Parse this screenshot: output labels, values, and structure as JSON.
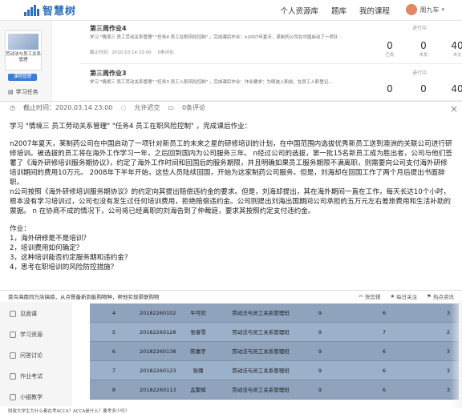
{
  "header": {
    "logo_text": "智慧树",
    "nav": [
      "个人资源库",
      "题库",
      "我的课程"
    ],
    "user_name": "周九车"
  },
  "sidebar": {
    "course_title": "劳动法与员工关系管理",
    "course_button": "课程管理",
    "item": "学习任务"
  },
  "tasks": [
    {
      "title": "第三周作业4",
      "desc": "学习 \"情境三 员工劳动关系管理\" \"任务4 员工在职风险控制\" ，完成课后作业：n2007年夏天，某制药公司在中国启动了一项针...",
      "deadline": "截止时间：2020.03.14 23:00",
      "comments": "0条评论",
      "status": "进行中",
      "stats": [
        {
          "n": "0",
          "l": "已批"
        },
        {
          "n": "0",
          "l": "未批"
        },
        {
          "n": "40",
          "l": "未交"
        }
      ]
    },
    {
      "title": "第三周作业3",
      "desc": "学习 \"情境三 员工劳动关系管理\" \"任务3 员工入职风险控制\" ，完成课后作业：作业要求：为明迪入职前，在员工入职登记...",
      "deadline": "截止时间：2020.03.14 23:00",
      "comments": "0条评论",
      "status": "进行中",
      "stats": [
        {
          "n": "0",
          "l": "已批"
        },
        {
          "n": "0",
          "l": "未批"
        },
        {
          "n": "40",
          "l": "未交"
        }
      ]
    }
  ],
  "popup": {
    "deadline": "截止时间：2020.03.14 23:00",
    "late": "允许迟交",
    "comments": "0条评论",
    "intro": "学习 \"情境三 员工劳动关系管理\" \"任务4 员工在职风险控制\" ，完成课后作业：",
    "para1": "n2007年夏天，某制药公司在中国启动了一项针对新员工的未来之星的研修培训的计划，在中国范围内选拔优秀新员工送到澳洲的关联公司进行研修培训。被选拔的员工将在海外工作学习一年，之后回到国内为公司服务三年。 n经过公司的选拔，第一批15名新员工成为胜出者，公司与他们签署了《海外研修培训服务期协议》，约定了海外工作时间和回国后的服务期限，并且明确如果员工服务期限不满离职，则需要向公司支付海外研修培训期间的费用10万元。 2008年下半年开始，这些人员陆续回国，开始为这家制药公司服务。但是，刘海却在回国工作了两个月后提出书面辞职。",
    "para2": "n公司按照《海外研修培训服务期协议》的约定向其提出赔偿违约金的要求。但是，刘海却提出，其在海外期间一直在工作，每天长达10个小时，根本没有学习培训过，公司也没有发生过任何培训费用，拒绝赔偿违约金。公司则提出刘海出国期间公司承担的五万元左右差旅费用和生活补助的票据。 n 在协商不成的情况下，公司将已经离职的刘海告到了仲裁庭，要求其按照约定支付违约金。",
    "task_label": "作业：",
    "questions": [
      "1，海外研修是不是培训？",
      "2，培训费用如何确定？",
      "3，这种培训能否约定服务期和违约金？",
      "4，思考在职培训的风险防控措施？"
    ]
  },
  "bottom": {
    "marquee": "菜鸟海南同万店搞掠，从点餐备新到能购物种，帮他实现渠联购物",
    "right_links": [
      "快剪辑",
      "每日关注",
      "热点资讯"
    ],
    "side_items": [
      "见面课",
      "学习资源",
      "问答讨论",
      "作业考试",
      "小组教学"
    ],
    "rows": [
      {
        "num": "4",
        "id": "20182260102",
        "name": "牛可欣",
        "class": "劳动法与员工关系管理班",
        "a": "9",
        "b": "6",
        "c": "3"
      },
      {
        "num": "5",
        "id": "20182260128",
        "name": "张睿雪",
        "class": "劳动法与员工关系管理班",
        "a": "9",
        "b": "7",
        "c": "2"
      },
      {
        "num": "6",
        "id": "20182260138",
        "name": "陈嘉宇",
        "class": "劳动法与员工关系管理班",
        "a": "9",
        "b": "6",
        "c": "3"
      },
      {
        "num": "7",
        "id": "20182260123",
        "name": "张璐",
        "class": "劳动法与员工关系管理班",
        "a": "9",
        "b": "6",
        "c": "3"
      },
      {
        "num": "8",
        "id": "20182260113",
        "name": "孟繁辉",
        "class": "劳动法与员工关系管理班",
        "a": "9",
        "b": "6",
        "c": "3"
      }
    ],
    "footer": "财政大学生为什么都在考ACCA？ACCA是什么？要考多少吗？"
  }
}
